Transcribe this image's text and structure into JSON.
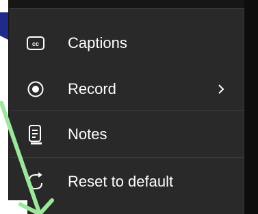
{
  "menu": {
    "items": [
      {
        "label": "Captions",
        "icon": "closed-captions-icon"
      },
      {
        "label": "Record",
        "icon": "record-icon",
        "has_submenu": true
      },
      {
        "label": "Notes",
        "icon": "notes-icon"
      },
      {
        "label": "Reset to default",
        "icon": "reset-icon"
      }
    ]
  },
  "colors": {
    "menu_bg": "#292929",
    "text": "#ffffff",
    "annotation_arrow_green": "#9be79b",
    "annotation_arrow_blue": "#1f2a8a"
  }
}
